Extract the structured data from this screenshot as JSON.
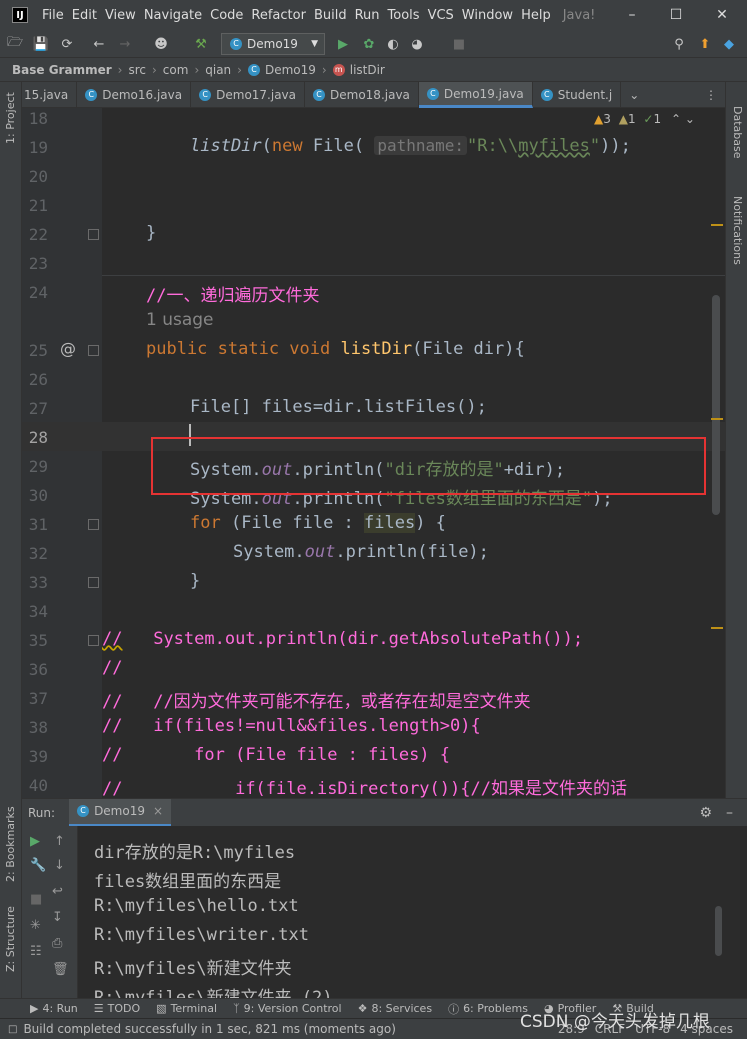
{
  "menubar": {
    "logo": "IJ",
    "items": [
      "File",
      "Edit",
      "View",
      "Navigate",
      "Code",
      "Refactor",
      "Build",
      "Run",
      "Tools",
      "VCS",
      "Window",
      "Help"
    ],
    "title": "Java!"
  },
  "toolbar": {
    "run_config": "Demo19"
  },
  "breadcrumb": [
    "Base Grammer",
    "src",
    "com",
    "qian",
    "Demo19",
    "listDir"
  ],
  "tabs": [
    "15.java",
    "Demo16.java",
    "Demo17.java",
    "Demo18.java",
    "Demo19.java",
    "Student.j"
  ],
  "inspections": {
    "warnings": "3",
    "weak": "1",
    "typos": "1"
  },
  "side": {
    "project": "1: Project",
    "database": "Database",
    "notifications": "Notifications",
    "bookmarks": "2: Bookmarks",
    "structure": "Z: Structure"
  },
  "code": {
    "line_numbers": [
      "18",
      "19",
      "20",
      "21",
      "22",
      "23",
      "24",
      "25",
      "26",
      "27",
      "28",
      "29",
      "30",
      "31",
      "32",
      "33",
      "34",
      "35",
      "36",
      "37",
      "38",
      "39",
      "40"
    ],
    "l19_fn": "listDir",
    "l19_new": "new",
    "l19_cls": "File(",
    "l19_hint": "pathname:",
    "l19_str_a": "\"R:\\\\",
    "l19_str_b": "myfiles",
    "l19_str_c": "\"",
    "l19_end": "));",
    "l22": "}",
    "l24": "//一、递归遍历文件夹",
    "usage": "1 usage",
    "l25_kw": "public static void ",
    "l25_fn": "listDir",
    "l25_rest": "(File dir){",
    "l27": "File[] files=dir.listFiles();",
    "l29_a": "System.",
    "l29_out": "out",
    "l29_b": ".println(",
    "l29_str": "\"dir存放的是\"",
    "l29_c": "+dir);",
    "l30_str": "\"files数组里面的东西是\"",
    "l30_c": ");",
    "l31_for": "for",
    "l31_a": " (File file : ",
    "l31_files": "files",
    "l31_b": ") {",
    "l32_c": ".println(file);",
    "l33": "}",
    "l35_a": "//",
    "l35_b": "System.out.println(dir.getAbsolutePath());",
    "l36": "//",
    "l37_b": "//因为文件夹可能不存在，或者存在却是空文件夹",
    "l38_b": "if(files!=null&&files.length>0){",
    "l39_b": "for (File file : files) {",
    "l40_b": "if(file.isDirectory()){//如果是文件夹的话"
  },
  "run": {
    "label": "Run:",
    "tab": "Demo19",
    "output": [
      "dir存放的是R:\\myfiles",
      "files数组里面的东西是",
      "R:\\myfiles\\hello.txt",
      "R:\\myfiles\\writer.txt",
      "R:\\myfiles\\新建文件夹",
      "R:\\myfiles\\新建文件夹 (2)"
    ]
  },
  "bottom_tabs": [
    "4: Run",
    "TODO",
    "Terminal",
    "9: Version Control",
    "8: Services",
    "6: Problems",
    "Profiler",
    "Build"
  ],
  "status": {
    "message": "Build completed successfully in 1 sec, 821 ms (moments ago)",
    "position": "28:9",
    "line_sep": "CRLF",
    "encoding": "UTF-8",
    "indent": "4 spaces"
  },
  "watermark": "CSDN @今天头发掉几根"
}
